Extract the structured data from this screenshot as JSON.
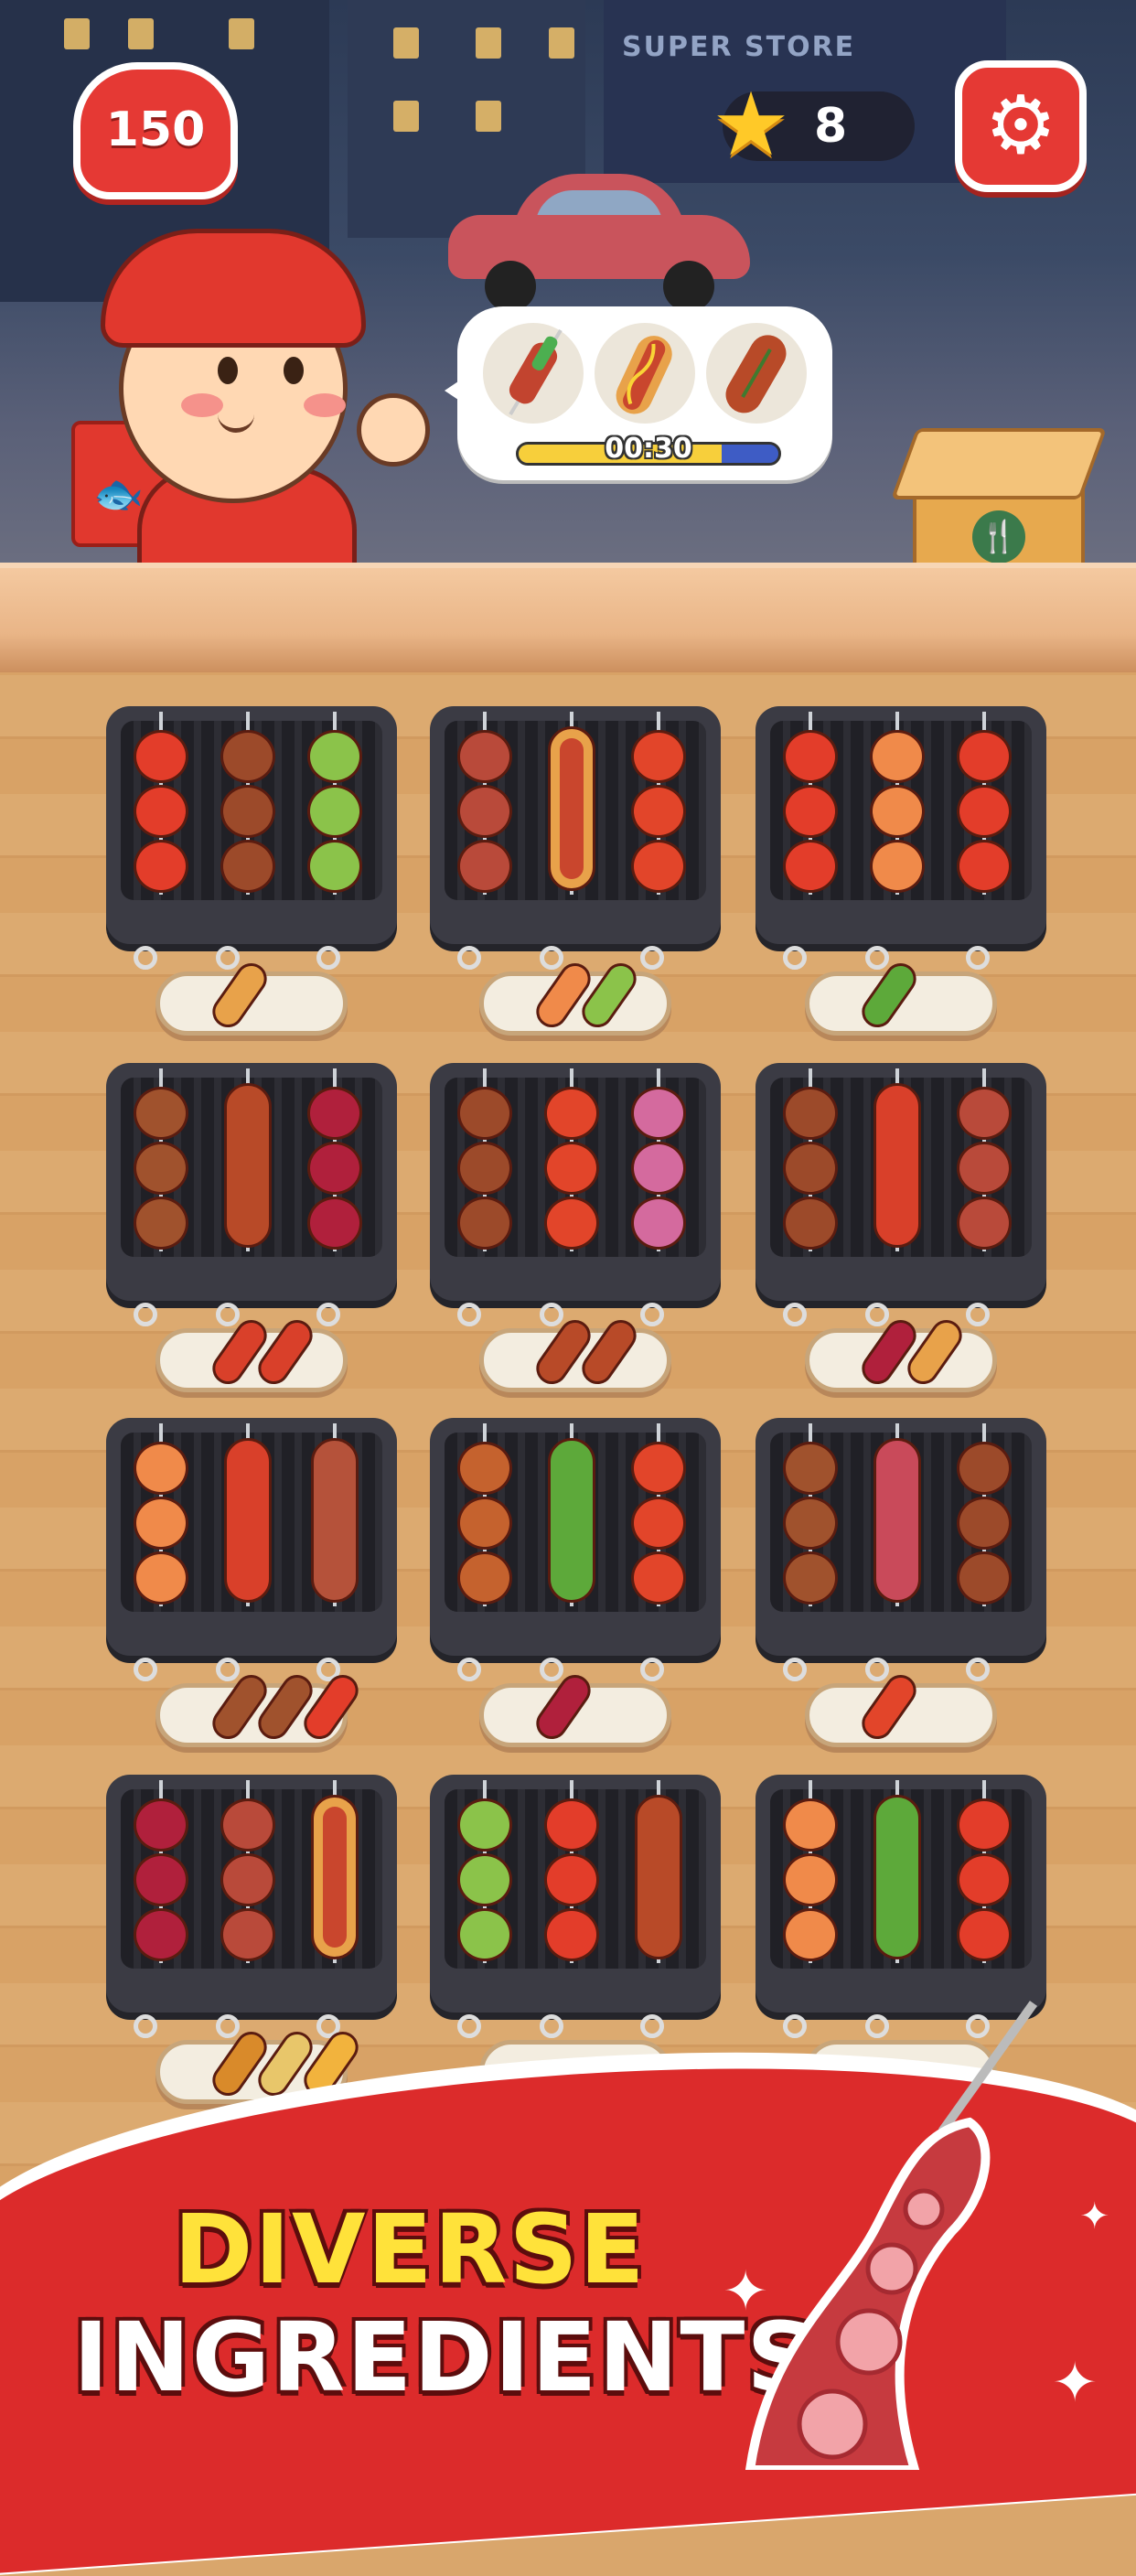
{
  "hud": {
    "coins": "150",
    "stars": "8",
    "settings_icon": "gear-icon",
    "star_icon": "star-icon"
  },
  "order": {
    "timer": "00:30",
    "timer_progress": 0.78,
    "items": [
      "asparagus-bacon-skewer-icon",
      "hotdog-icon",
      "grilled-sausage-icon"
    ]
  },
  "scene": {
    "store_sign": "SUPER STORE"
  },
  "grills": [
    {
      "items": [
        "tomato-skewer",
        "pork-belly-skewer",
        "veggie-skewer"
      ]
    },
    {
      "items": [
        "bacon-skewer",
        "hotdog",
        "crab-skewer"
      ]
    },
    {
      "items": [
        "tomato-skewer",
        "shrimp-skewer",
        "tomato-skewer"
      ]
    },
    {
      "items": [
        "pork-onion-skewer",
        "grilled-sausage",
        "beet-skewer"
      ]
    },
    {
      "items": [
        "pork-belly-skewer",
        "crab-skewer",
        "octopus-skewer"
      ]
    },
    {
      "items": [
        "pork-belly-skewer",
        "lobster",
        "bacon-skewer"
      ]
    },
    {
      "items": [
        "shrimp-skewer",
        "lobster",
        "sausage-skewer"
      ]
    },
    {
      "items": [
        "meatball-skewer",
        "asparagus-bacon-skewer",
        "crab-skewer"
      ]
    },
    {
      "items": [
        "pork-onion-skewer",
        "octopus-tentacle",
        "pork-belly-skewer"
      ]
    },
    {
      "items": [
        "beet-skewer",
        "bacon-skewer",
        "hotdog"
      ]
    },
    {
      "items": [
        "veggie-skewer",
        "tomato-skewer",
        "grilled-sausage"
      ]
    },
    {
      "items": [
        "shrimp-skewer",
        "asparagus-bacon-skewer",
        "tomato-skewer"
      ]
    }
  ],
  "colors": {
    "accent_red": "#e53934",
    "title_yellow": "#ffe23a",
    "banner_red": "#dc2b2b"
  },
  "banner": {
    "line1": "DIVERSE",
    "line2": "INGREDIENTS"
  }
}
